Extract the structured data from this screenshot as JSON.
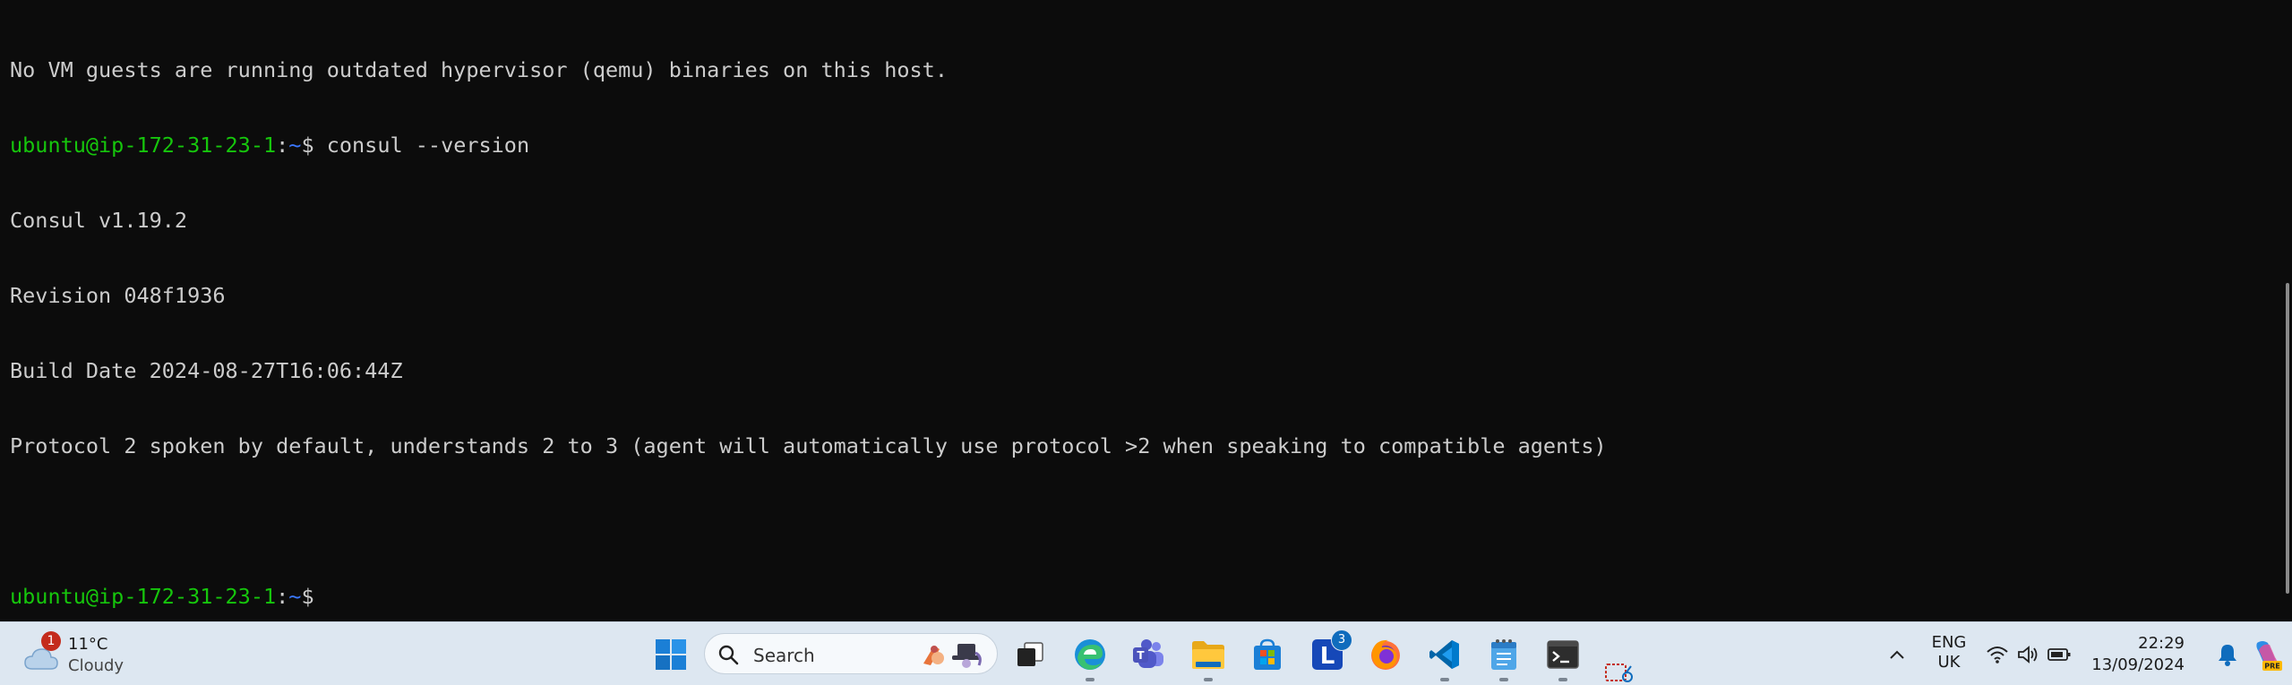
{
  "terminal": {
    "lines": [
      {
        "user": "",
        "colon": "",
        "path": "",
        "text": "No VM guests are running outdated hypervisor (qemu) binaries on this host."
      },
      {
        "user": "ubuntu@ip-172-31-23-1",
        "colon": ":",
        "path": "~",
        "text": "$ consul --version"
      },
      {
        "user": "",
        "colon": "",
        "path": "",
        "text": "Consul v1.19.2"
      },
      {
        "user": "",
        "colon": "",
        "path": "",
        "text": "Revision 048f1936"
      },
      {
        "user": "",
        "colon": "",
        "path": "",
        "text": "Build Date 2024-08-27T16:06:44Z"
      },
      {
        "user": "",
        "colon": "",
        "path": "",
        "text": "Protocol 2 spoken by default, understands 2 to 3 (agent will automatically use protocol >2 when speaking to compatible agents)"
      },
      {
        "user": "",
        "colon": "",
        "path": "",
        "text": ""
      },
      {
        "user": "ubuntu@ip-172-31-23-1",
        "colon": ":",
        "path": "~",
        "text": "$"
      }
    ],
    "colors": {
      "background": "#0c0c0c",
      "text": "#cccccc",
      "prompt_user": "#16c60c",
      "prompt_path": "#3b78ff"
    }
  },
  "taskbar": {
    "weather": {
      "badge": "1",
      "temp": "11°C",
      "condition": "Cloudy",
      "icon": "cloud-icon"
    },
    "search": {
      "label": "Search"
    },
    "apps": [
      {
        "name": "start-button",
        "icon": "windows-logo-icon"
      },
      {
        "name": "task-view-button",
        "icon": "task-view-icon"
      },
      {
        "name": "edge-button",
        "icon": "edge-icon"
      },
      {
        "name": "teams-button",
        "icon": "teams-icon"
      },
      {
        "name": "file-explorer-button",
        "icon": "folder-icon"
      },
      {
        "name": "store-button",
        "icon": "store-icon"
      },
      {
        "name": "l-app-button",
        "icon": "l-app-icon",
        "badge": "3",
        "letter": "L"
      },
      {
        "name": "firefox-button",
        "icon": "firefox-icon"
      },
      {
        "name": "vscode-button",
        "icon": "vscode-icon"
      },
      {
        "name": "notepad-button",
        "icon": "notepad-icon"
      },
      {
        "name": "terminal-button",
        "icon": "terminal-icon"
      },
      {
        "name": "snipping-tool-button",
        "icon": "snipping-icon"
      }
    ],
    "tray": {
      "language_top": "ENG",
      "language_bottom": "UK",
      "time": "22:29",
      "date": "13/09/2024",
      "copilot_badge": "PRE"
    },
    "colors": {
      "background": "#dde7f1",
      "accent": "#0f6cbd"
    }
  }
}
